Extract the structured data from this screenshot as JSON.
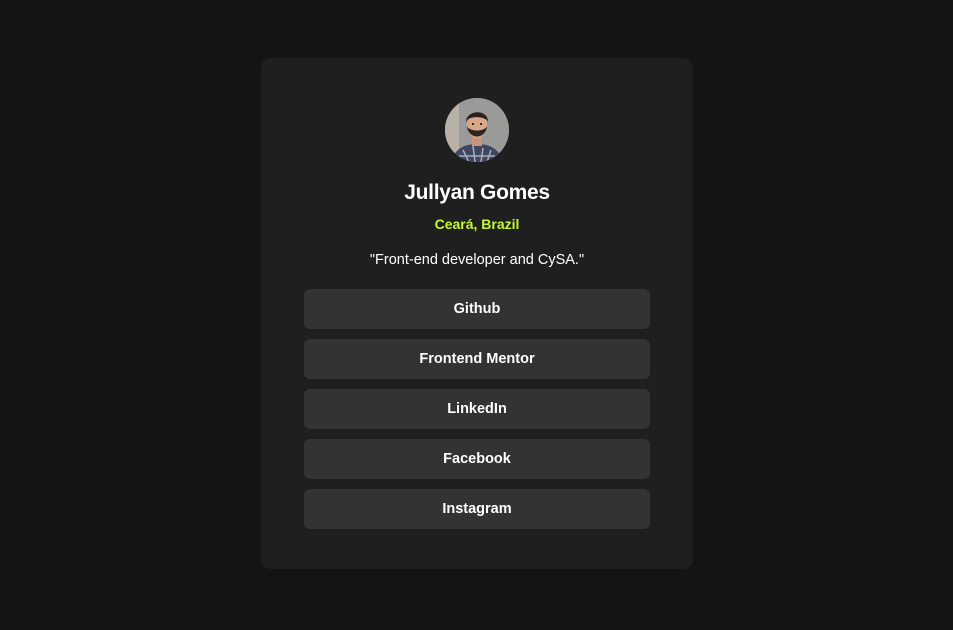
{
  "profile": {
    "name": "Jullyan Gomes",
    "location": "Ceará, Brazil",
    "bio": "\"Front-end developer and CySA.\"",
    "avatar_icon": "profile-photo"
  },
  "links": [
    {
      "label": "Github"
    },
    {
      "label": "Frontend Mentor"
    },
    {
      "label": "LinkedIn"
    },
    {
      "label": "Facebook"
    },
    {
      "label": "Instagram"
    }
  ],
  "colors": {
    "page_background": "#141414",
    "card_background": "#1f1f1f",
    "button_background": "#333333",
    "accent": "#c5f82a",
    "text": "#ffffff"
  }
}
